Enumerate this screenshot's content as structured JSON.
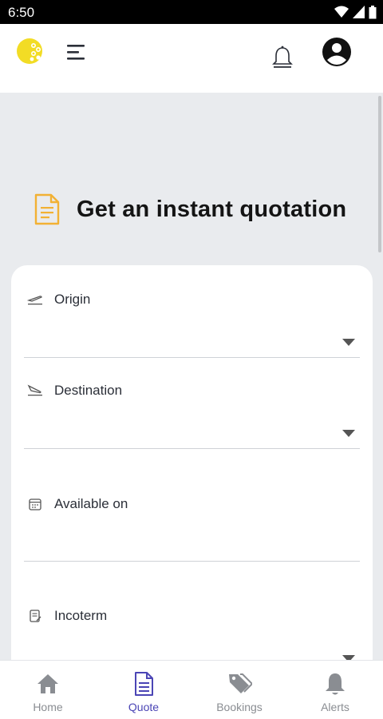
{
  "status_bar": {
    "time": "6:50"
  },
  "header": {
    "logo": "logo-icon",
    "menu_icon": "menu-icon",
    "notifications_icon": "bell-icon",
    "account_icon": "account-icon"
  },
  "page": {
    "title": "Get an instant quotation",
    "title_icon": "document-icon"
  },
  "form": {
    "origin": {
      "label": "Origin",
      "value": "",
      "icon": "takeoff-icon"
    },
    "destination": {
      "label": "Destination",
      "value": "",
      "icon": "landing-icon"
    },
    "available_on": {
      "label": "Available on",
      "value": "",
      "icon": "calendar-icon"
    },
    "incoterm": {
      "label": "Incoterm",
      "value": "",
      "icon": "contract-icon"
    }
  },
  "bottom_nav": {
    "items": [
      {
        "label": "Home",
        "icon": "home-icon",
        "active": false
      },
      {
        "label": "Quote",
        "icon": "quote-icon",
        "active": true
      },
      {
        "label": "Bookings",
        "icon": "tag-icon",
        "active": false
      },
      {
        "label": "Alerts",
        "icon": "bell-icon",
        "active": false
      }
    ]
  },
  "colors": {
    "accent": "#4b45b5",
    "logo_yellow": "#f2dc25",
    "doc_orange": "#f2b134"
  }
}
